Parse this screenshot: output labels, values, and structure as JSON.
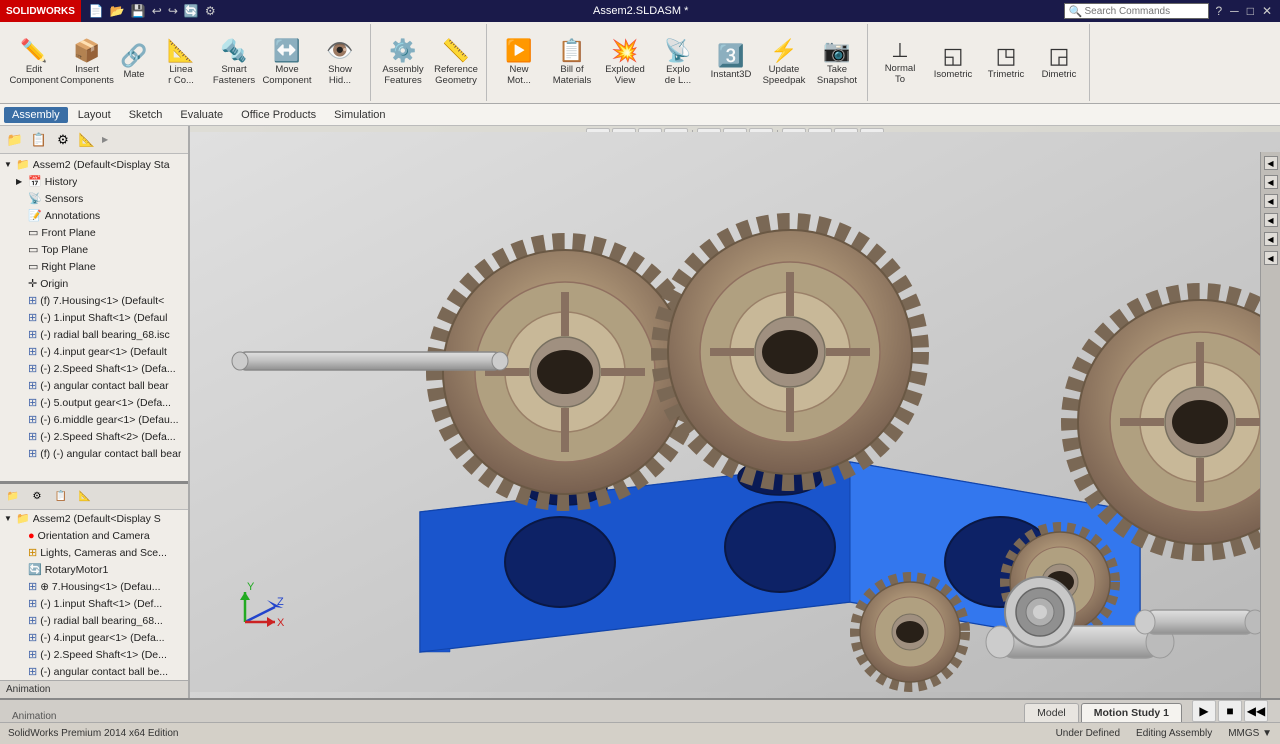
{
  "app": {
    "name": "SOLIDWORKS",
    "title": "Assem2.SLDASM *",
    "version": "SolidWorks Premium 2014 x64 Edition",
    "search_placeholder": "Search Commands"
  },
  "status": {
    "under_defined": "Under Defined",
    "editing": "Editing Assembly",
    "coords": "MMGS ▼"
  },
  "toolbar": {
    "groups": [
      {
        "name": "component",
        "items": [
          {
            "id": "edit-component",
            "label": "Edit\nComponent",
            "icon": "✏️"
          },
          {
            "id": "insert-components",
            "label": "Insert\nComponents",
            "icon": "📦"
          },
          {
            "id": "mate",
            "label": "Mate",
            "icon": "🔗"
          },
          {
            "id": "linear-component",
            "label": "Linea\nr Co...",
            "icon": "📐"
          },
          {
            "id": "smart-fasteners",
            "label": "Smart\nFasteners",
            "icon": "🔩"
          },
          {
            "id": "move-component",
            "label": "Move\nComponent",
            "icon": "↔️"
          },
          {
            "id": "show-hide",
            "label": "Show\nHid...",
            "icon": "👁️"
          }
        ]
      },
      {
        "name": "assembly",
        "items": [
          {
            "id": "assembly-features",
            "label": "Assembly\nFeatures",
            "icon": "⚙️"
          },
          {
            "id": "reference-geometry",
            "label": "Reference\nGeometry",
            "icon": "📏"
          }
        ]
      },
      {
        "name": "view",
        "items": [
          {
            "id": "new-motion",
            "label": "New\nMot...",
            "icon": "▶️"
          },
          {
            "id": "bill-of-materials",
            "label": "Bill of\nMaterials",
            "icon": "📋"
          },
          {
            "id": "exploded-view",
            "label": "Exploded\nView",
            "icon": "💥"
          },
          {
            "id": "explode-line",
            "label": "Explo\nde L...",
            "icon": "📡"
          },
          {
            "id": "instant3d",
            "label": "Instant3D",
            "icon": "3️⃣"
          },
          {
            "id": "update-speedpak",
            "label": "Update\nSpeedpak",
            "icon": "⚡"
          },
          {
            "id": "take-snapshot",
            "label": "Take\nSnapshot",
            "icon": "📷"
          }
        ]
      },
      {
        "name": "orientation",
        "items": [
          {
            "id": "normal-to",
            "label": "Normal\nTo",
            "icon": "⊥"
          },
          {
            "id": "isometric",
            "label": "Isometric",
            "icon": "◱"
          },
          {
            "id": "trimetric",
            "label": "Trimetric",
            "icon": "◳"
          },
          {
            "id": "dimetric",
            "label": "Dimetric",
            "icon": "◲"
          }
        ]
      }
    ]
  },
  "menubar": {
    "items": [
      "Assembly",
      "Layout",
      "Sketch",
      "Evaluate",
      "Office Products",
      "Simulation"
    ]
  },
  "sidebar": {
    "title": "Assem2",
    "tree_items": [
      {
        "id": "assem2-root",
        "label": "Assem2  (Default<Display Sta",
        "indent": 0,
        "icon": "📁",
        "expander": "▼"
      },
      {
        "id": "history",
        "label": "History",
        "indent": 1,
        "icon": "📅",
        "expander": "▶"
      },
      {
        "id": "sensors",
        "label": "Sensors",
        "indent": 1,
        "icon": "📡",
        "expander": ""
      },
      {
        "id": "annotations",
        "label": "Annotations",
        "indent": 1,
        "icon": "📝",
        "expander": ""
      },
      {
        "id": "front-plane",
        "label": "Front Plane",
        "indent": 1,
        "icon": "▭",
        "expander": ""
      },
      {
        "id": "top-plane",
        "label": "Top Plane",
        "indent": 1,
        "icon": "▭",
        "expander": ""
      },
      {
        "id": "right-plane",
        "label": "Right Plane",
        "indent": 1,
        "icon": "▭",
        "expander": ""
      },
      {
        "id": "origin",
        "label": "Origin",
        "indent": 1,
        "icon": "✛",
        "expander": ""
      },
      {
        "id": "housing",
        "label": "(f) 7.Housing<1> (Default<",
        "indent": 1,
        "icon": "⚙",
        "expander": ""
      },
      {
        "id": "input-shaft",
        "label": "(-) 1.input Shaft<1> (Defaul",
        "indent": 1,
        "icon": "⚙",
        "expander": ""
      },
      {
        "id": "radial-ball",
        "label": "(-) radial ball bearing_68.isc",
        "indent": 1,
        "icon": "⚙",
        "expander": ""
      },
      {
        "id": "input-gear",
        "label": "(-) 4.input gear<1> (Default",
        "indent": 1,
        "icon": "⚙",
        "expander": ""
      },
      {
        "id": "speed-shaft1",
        "label": "(-) 2.Speed Shaft<1> (Defa...",
        "indent": 1,
        "icon": "⚙",
        "expander": ""
      },
      {
        "id": "angular-contact",
        "label": "(-) angular contact ball bear",
        "indent": 1,
        "icon": "⚙",
        "expander": ""
      },
      {
        "id": "output-gear",
        "label": "(-) 5.output gear<1> (Defa...",
        "indent": 1,
        "icon": "⚙",
        "expander": ""
      },
      {
        "id": "middle-gear",
        "label": "(-) 6.middle gear<1> (Defau...",
        "indent": 1,
        "icon": "⚙",
        "expander": ""
      },
      {
        "id": "speed-shaft2",
        "label": "(-) 2.Speed Shaft<2> (Defa...",
        "indent": 1,
        "icon": "⚙",
        "expander": ""
      },
      {
        "id": "angular-contact2",
        "label": "(f) (-) angular contact ball bear",
        "indent": 1,
        "icon": "⚙",
        "expander": ""
      }
    ],
    "tree_items2": [
      {
        "id": "assem2-root2",
        "label": "Assem2  (Default<Display S",
        "indent": 0,
        "icon": "📁",
        "expander": "▼"
      },
      {
        "id": "orientation-camera",
        "label": "Orientation and Camera",
        "indent": 1,
        "icon": "🎥",
        "expander": "",
        "color": "red"
      },
      {
        "id": "lights-cameras",
        "label": "Lights, Cameras and Sce...",
        "indent": 1,
        "icon": "💡",
        "expander": ""
      },
      {
        "id": "rotary-motor",
        "label": "RotaryMotor1",
        "indent": 1,
        "icon": "🔄",
        "expander": ""
      },
      {
        "id": "housing2",
        "label": "⊕ 7.Housing<1> (Defau...",
        "indent": 1,
        "icon": "⚙",
        "expander": ""
      },
      {
        "id": "input-shaft2",
        "label": "(-) 1.input Shaft<1> (Def...",
        "indent": 1,
        "icon": "⚙",
        "expander": ""
      },
      {
        "id": "radial-ball2",
        "label": "(-) radial ball bearing_68...",
        "indent": 1,
        "icon": "⚙",
        "expander": ""
      },
      {
        "id": "input-gear2",
        "label": "(-) 4.input gear<1> (Defa...",
        "indent": 1,
        "icon": "⚙",
        "expander": ""
      },
      {
        "id": "speed-shaft1b",
        "label": "(-) 2.Speed Shaft<1> (De...",
        "indent": 1,
        "icon": "⚙",
        "expander": ""
      },
      {
        "id": "angular-contact1b",
        "label": "(-) angular contact ball be...",
        "indent": 1,
        "icon": "⚙",
        "expander": ""
      }
    ],
    "animation_label": "Animation"
  },
  "bottom_tabs": {
    "tabs": [
      {
        "id": "model",
        "label": "Model",
        "active": false
      },
      {
        "id": "motion-study-1",
        "label": "Motion Study 1",
        "active": true
      }
    ]
  },
  "viewport_toolbar": {
    "buttons": [
      "🔍",
      "🔎",
      "✋",
      "↗",
      "🖱",
      "□",
      "▽",
      "◁",
      "⬡",
      "⬤",
      "🌐"
    ]
  },
  "right_panel": {
    "buttons": [
      "◀",
      "◀",
      "◀",
      "◀",
      "◀",
      "◀"
    ]
  }
}
